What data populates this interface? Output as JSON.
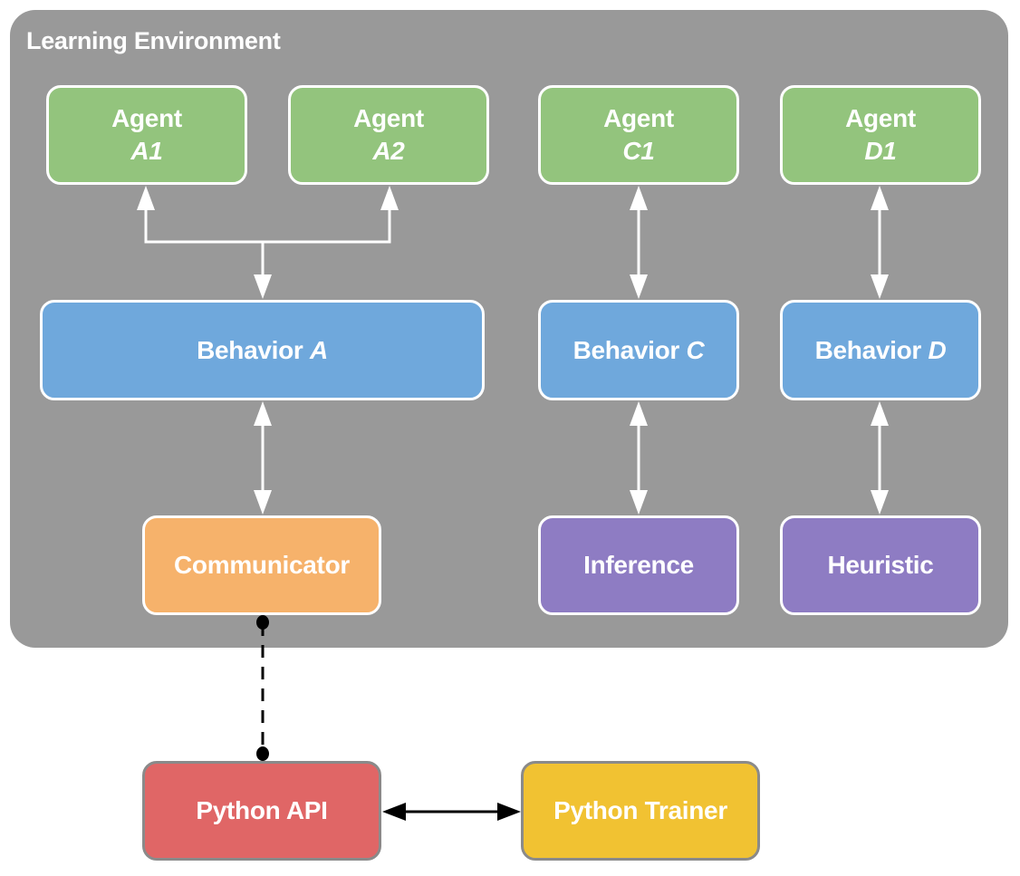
{
  "environment": {
    "title": "Learning Environment"
  },
  "agents": [
    {
      "label": "Agent",
      "id": "A1"
    },
    {
      "label": "Agent",
      "id": "A2"
    },
    {
      "label": "Agent",
      "id": "C1"
    },
    {
      "label": "Agent",
      "id": "D1"
    }
  ],
  "behaviors": [
    {
      "label": "Behavior",
      "id": "A"
    },
    {
      "label": "Behavior",
      "id": "C"
    },
    {
      "label": "Behavior",
      "id": "D"
    }
  ],
  "components": {
    "communicator": "Communicator",
    "inference": "Inference",
    "heuristic": "Heuristic",
    "python_api": "Python API",
    "python_trainer": "Python Trainer"
  },
  "colors": {
    "environment": "#999999",
    "agent": "#93c47d",
    "behavior": "#6fa8dc",
    "communicator": "#f6b26b",
    "inference": "#8e7cc3",
    "python_api": "#e06666",
    "python_trainer": "#f1c232"
  }
}
